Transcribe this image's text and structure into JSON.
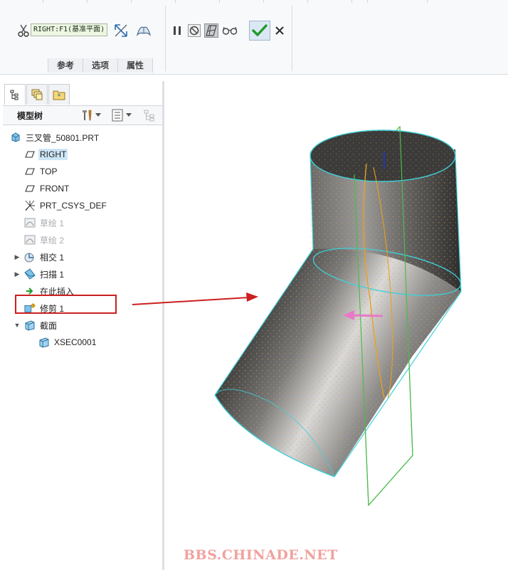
{
  "ribbon": {
    "reference_field": "RIGHT:F1(基准平面)",
    "tabs": [
      "参考",
      "选项",
      "属性"
    ],
    "icons": [
      "scissors-icon",
      "flip-arrows-icon",
      "thicken-sheet-icon",
      "pause-icon",
      "no-preview-icon",
      "preview-icon",
      "glasses-icon",
      "ok-checkmark-icon",
      "cancel-x-icon"
    ]
  },
  "panel": {
    "tabs": [
      "model-tree-tab-icon",
      "layers-tab-icon",
      "favorites-tab-icon"
    ],
    "title": "模型树"
  },
  "tree": {
    "items": [
      {
        "label": "三叉管_50801.PRT",
        "icon": "part-icon",
        "expander": ""
      },
      {
        "label": "RIGHT",
        "icon": "datum-plane-icon",
        "expander": "",
        "highlighted": true
      },
      {
        "label": "TOP",
        "icon": "datum-plane-icon",
        "expander": ""
      },
      {
        "label": "FRONT",
        "icon": "datum-plane-icon",
        "expander": ""
      },
      {
        "label": "PRT_CSYS_DEF",
        "icon": "csys-icon",
        "expander": ""
      },
      {
        "label": "草绘 1",
        "icon": "sketch-icon",
        "expander": "",
        "dim": true
      },
      {
        "label": "草绘 2",
        "icon": "sketch-icon",
        "expander": "",
        "dim": true
      },
      {
        "label": "相交 1",
        "icon": "intersect-icon",
        "expander": "▶"
      },
      {
        "label": "扫描 1",
        "icon": "sweep-icon",
        "expander": "▶"
      },
      {
        "label": "在此插入",
        "icon": "insert-here-icon",
        "expander": ""
      },
      {
        "label": "修剪 1",
        "icon": "trim-icon",
        "expander": ""
      },
      {
        "label": "截面",
        "icon": "section-folder-icon",
        "expander": "▼"
      },
      {
        "label": "XSEC0001",
        "icon": "xsection-icon",
        "expander": ""
      }
    ]
  },
  "viewport": {
    "watermark": "BBS.CHINADE.NET",
    "colors": {
      "surface_edge": "#3fd0d8",
      "mesh": "#f0a030",
      "datum_plane": "#4cbb4c",
      "curve": "#e8a020",
      "direction_arrow": "#e879c6",
      "callout_arrow": "#cc1f1f"
    }
  }
}
